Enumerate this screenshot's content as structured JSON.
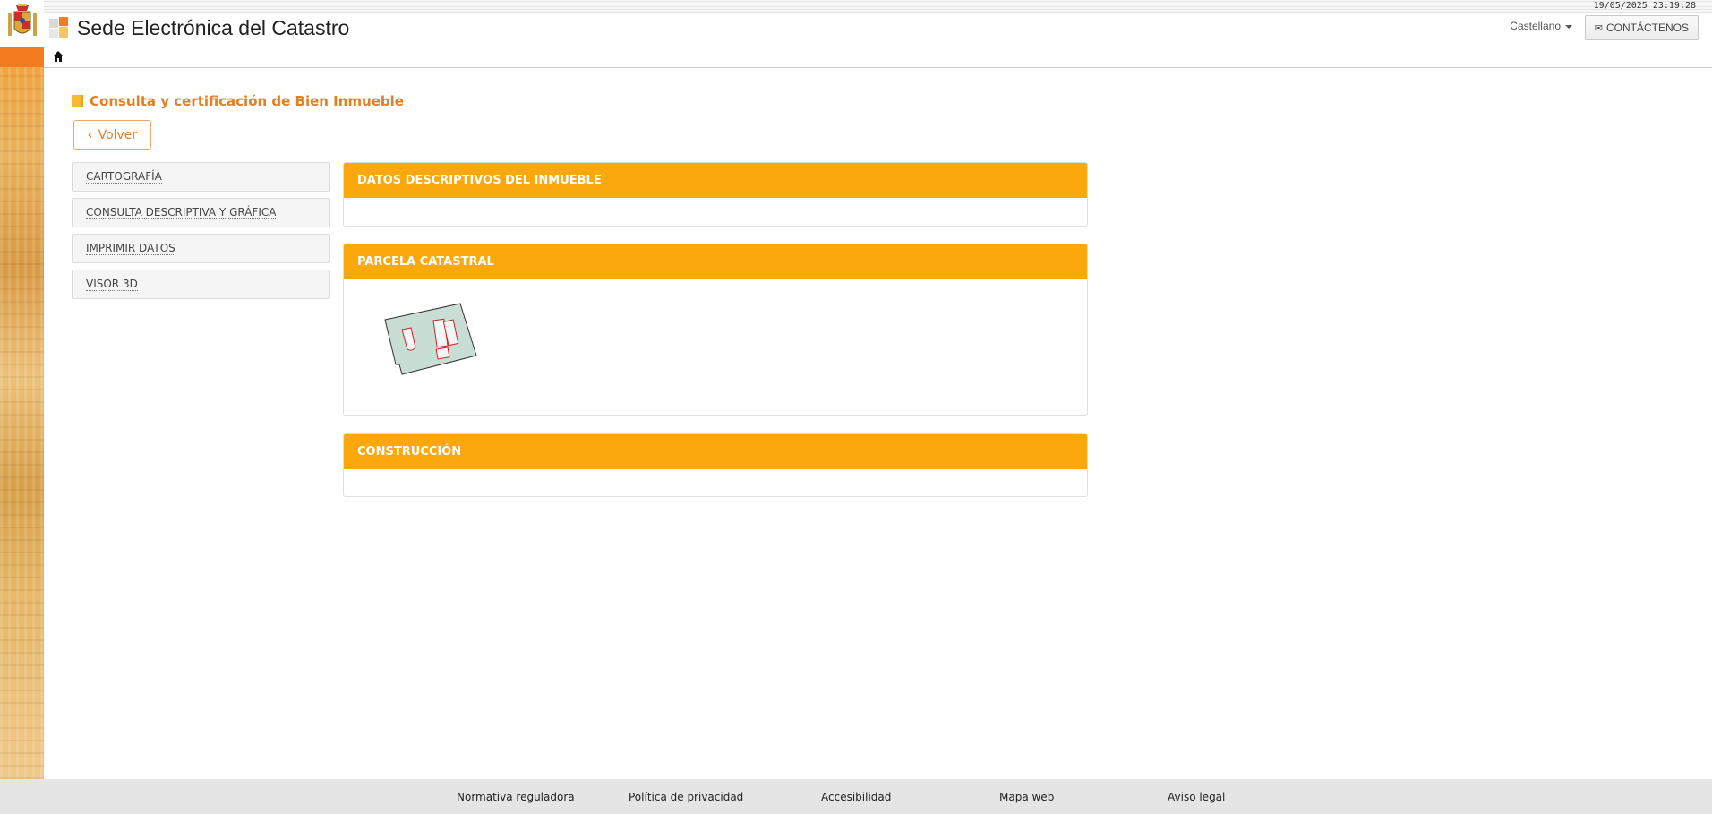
{
  "header": {
    "datetime": "19/05/2025  23:19:28",
    "site_title": "Sede Electrónica del Catastro",
    "language": "Castellano",
    "contact_label": "CONTÁCTENOS"
  },
  "page": {
    "heading": "Consulta y certificación de Bien Inmueble",
    "back_label": "Volver"
  },
  "sidebar": {
    "items": [
      {
        "label": "CARTOGRAFÍA"
      },
      {
        "label": "CONSULTA DESCRIPTIVA Y GRÁFICA"
      },
      {
        "label": "IMPRIMIR DATOS"
      },
      {
        "label": "VISOR 3D"
      }
    ]
  },
  "panels": [
    {
      "title": "DATOS DESCRIPTIVOS DEL INMUEBLE"
    },
    {
      "title": "PARCELA CATASTRAL"
    },
    {
      "title": "CONSTRUCCIÓN"
    }
  ],
  "footer": {
    "links": [
      {
        "label": "Normativa reguladora"
      },
      {
        "label": "Política de privacidad"
      },
      {
        "label": "Accesibilidad"
      },
      {
        "label": "Mapa web"
      },
      {
        "label": "Aviso legal"
      }
    ]
  },
  "colors": {
    "accent_orange": "#fba80c",
    "heading_orange": "#e67e22",
    "parcel_fill": "#c8ddd3",
    "building_outline": "#d0202a"
  }
}
